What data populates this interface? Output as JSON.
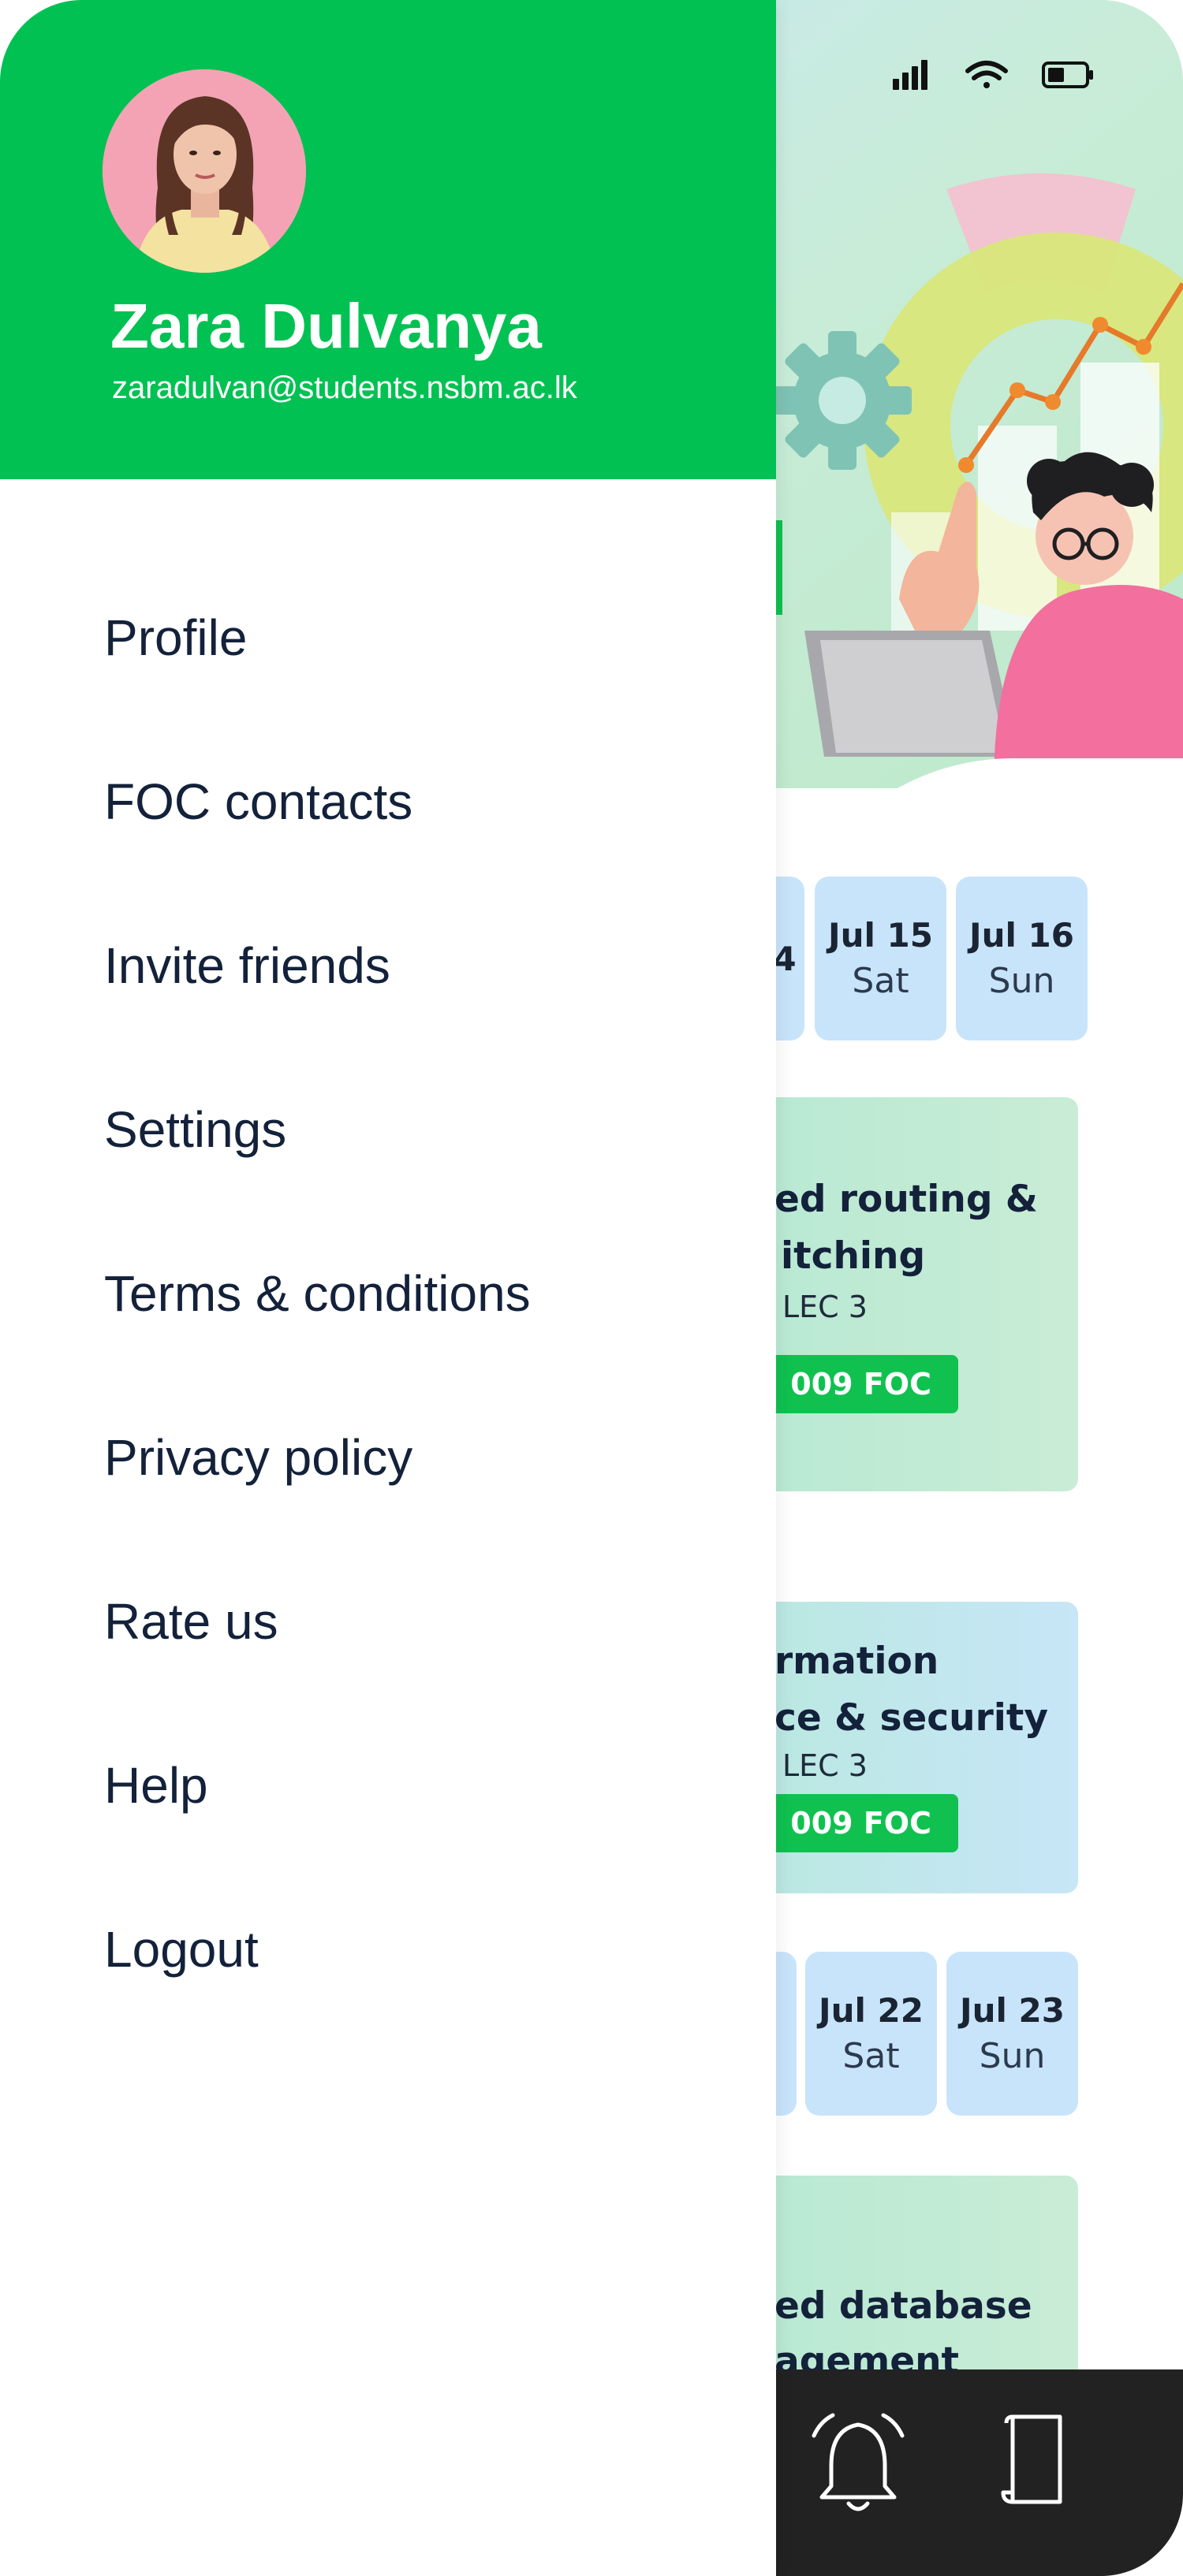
{
  "drawer": {
    "user": {
      "name": "Zara Dulvanya",
      "email": "zaradulvan@students.nsbm.ac.lk"
    },
    "menu": [
      {
        "label": "Profile"
      },
      {
        "label": "FOC contacts"
      },
      {
        "label": "Invite friends"
      },
      {
        "label": "Settings"
      },
      {
        "label": "Terms & conditions"
      },
      {
        "label": "Privacy policy"
      },
      {
        "label": "Rate us"
      },
      {
        "label": "Help"
      },
      {
        "label": "Logout"
      }
    ]
  },
  "background": {
    "week1": [
      {
        "date": "4",
        "day": ""
      },
      {
        "date": "Jul 15",
        "day": "Sat"
      },
      {
        "date": "Jul 16",
        "day": "Sun"
      }
    ],
    "card1": {
      "line1": "ed routing &",
      "line2": "itching",
      "lec": "LEC 3",
      "badge": "009 FOC"
    },
    "card2": {
      "line1": "rmation",
      "line2": "ce & security",
      "lec": "LEC 3",
      "badge": "009 FOC"
    },
    "week2": [
      {
        "date": "Jul 22",
        "day": "Sat"
      },
      {
        "date": "Jul 23",
        "day": "Sun"
      }
    ],
    "card3": {
      "line1": "ed database",
      "line2": "agement"
    }
  },
  "colors": {
    "brand_green": "#02c153",
    "badge_green": "#10c150",
    "chip_blue": "#c8e4fb",
    "text_dark": "#13213a",
    "nav_dark": "#222222"
  },
  "icons": [
    "signal-icon",
    "wifi-icon",
    "battery-icon",
    "bell-icon",
    "document-icon"
  ]
}
